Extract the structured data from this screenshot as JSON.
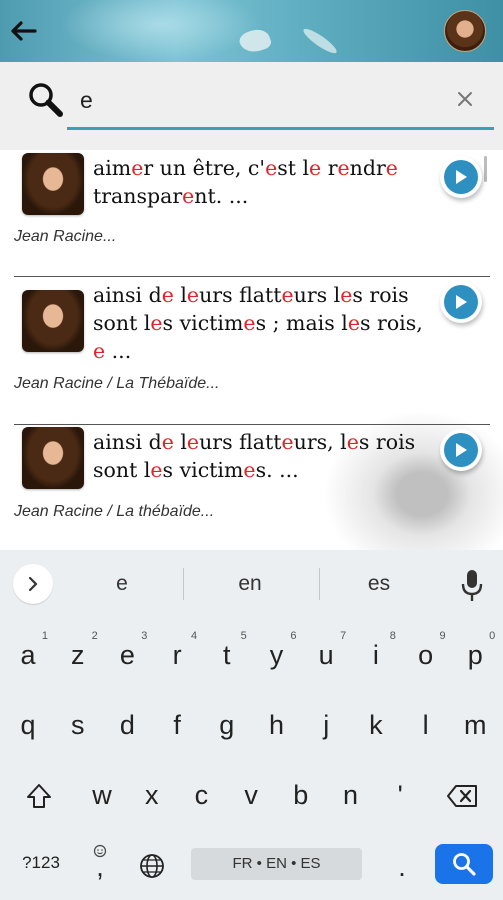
{
  "search": {
    "value": "e",
    "placeholder": ""
  },
  "results": [
    {
      "quote_parts": [
        {
          "t": "aim"
        },
        {
          "t": "e",
          "hl": true
        },
        {
          "t": "r un être, c'"
        },
        {
          "t": "e",
          "hl": true
        },
        {
          "t": "st l"
        },
        {
          "t": "e",
          "hl": true
        },
        {
          "t": " r"
        },
        {
          "t": "e",
          "hl": true
        },
        {
          "t": "ndr"
        },
        {
          "t": "e",
          "hl": true
        },
        {
          "t": " transpar"
        },
        {
          "t": "e",
          "hl": true
        },
        {
          "t": "nt. ..."
        }
      ],
      "author": "Jean Racine..."
    },
    {
      "quote_parts": [
        {
          "t": "ainsi d"
        },
        {
          "t": "e",
          "hl": true
        },
        {
          "t": " l"
        },
        {
          "t": "e",
          "hl": true
        },
        {
          "t": "urs flatt"
        },
        {
          "t": "e",
          "hl": true
        },
        {
          "t": "urs l"
        },
        {
          "t": "e",
          "hl": true
        },
        {
          "t": "s rois sont l"
        },
        {
          "t": "e",
          "hl": true
        },
        {
          "t": "s victim"
        },
        {
          "t": "e",
          "hl": true
        },
        {
          "t": "s ; mais l"
        },
        {
          "t": "e",
          "hl": true
        },
        {
          "t": "s rois, "
        },
        {
          "t": "e",
          "hl": true
        },
        {
          "t": " ..."
        }
      ],
      "author": "Jean Racine / La Thébaïde..."
    },
    {
      "quote_parts": [
        {
          "t": "ainsi d"
        },
        {
          "t": "e",
          "hl": true
        },
        {
          "t": " l"
        },
        {
          "t": "e",
          "hl": true
        },
        {
          "t": "urs flatt"
        },
        {
          "t": "e",
          "hl": true
        },
        {
          "t": "urs, l"
        },
        {
          "t": "e",
          "hl": true
        },
        {
          "t": "s rois sont l"
        },
        {
          "t": "e",
          "hl": true
        },
        {
          "t": "s victim"
        },
        {
          "t": "e",
          "hl": true
        },
        {
          "t": "s. ..."
        }
      ],
      "author": "Jean Racine / La thébaïde..."
    }
  ],
  "keyboard": {
    "suggestions": [
      "e",
      "en",
      "es"
    ],
    "row1": [
      {
        "k": "a",
        "h": "1"
      },
      {
        "k": "z",
        "h": "2"
      },
      {
        "k": "e",
        "h": "3"
      },
      {
        "k": "r",
        "h": "4"
      },
      {
        "k": "t",
        "h": "5"
      },
      {
        "k": "y",
        "h": "6"
      },
      {
        "k": "u",
        "h": "7"
      },
      {
        "k": "i",
        "h": "8"
      },
      {
        "k": "o",
        "h": "9"
      },
      {
        "k": "p",
        "h": "0"
      }
    ],
    "row2": [
      "q",
      "s",
      "d",
      "f",
      "g",
      "h",
      "j",
      "k",
      "l",
      "m"
    ],
    "row3": [
      "w",
      "x",
      "c",
      "v",
      "b",
      "n",
      "'"
    ],
    "numbers_label": "?123",
    "comma_label": ",",
    "space_label": "FR • EN • ES",
    "period_label": "."
  },
  "colors": {
    "accent": "#3d9fb4",
    "highlight": "#e0242b",
    "play": "#2e8fc1",
    "search_key": "#1a73e8"
  },
  "icons": [
    "back-arrow-icon",
    "search-icon",
    "close-icon",
    "play-icon",
    "chevron-right-icon",
    "mic-icon",
    "shift-icon",
    "backspace-icon",
    "emoji-icon",
    "globe-icon",
    "search-key-icon"
  ]
}
